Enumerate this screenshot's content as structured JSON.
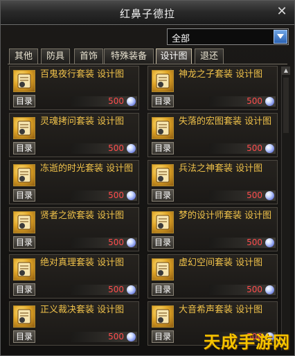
{
  "window": {
    "title": "红鼻子德拉"
  },
  "filter": {
    "selected": "全部"
  },
  "tabs": [
    {
      "label": "其他"
    },
    {
      "label": "防具"
    },
    {
      "label": "首饰"
    },
    {
      "label": "特殊装备"
    },
    {
      "label": "设计图"
    },
    {
      "label": "退还"
    }
  ],
  "active_tab": "设计图",
  "items": [
    {
      "name": "百鬼夜行套装  设计图",
      "catalog": "目录",
      "price": "500"
    },
    {
      "name": "神龙之子套装  设计图",
      "catalog": "目录",
      "price": "500"
    },
    {
      "name": "灵魂拷问套装  设计图",
      "catalog": "目录",
      "price": "500"
    },
    {
      "name": "失落的宏图套装  设计图",
      "catalog": "目录",
      "price": "500"
    },
    {
      "name": "冻逝的时光套装  设计图",
      "catalog": "目录",
      "price": "500"
    },
    {
      "name": "兵法之神套装  设计图",
      "catalog": "目录",
      "price": "500"
    },
    {
      "name": "贤者之欲套装  设计图",
      "catalog": "目录",
      "price": "500"
    },
    {
      "name": "梦的设计师套装  设计图",
      "catalog": "目录",
      "price": "500"
    },
    {
      "name": "绝对真理套装  设计图",
      "catalog": "目录",
      "price": "500"
    },
    {
      "name": "虚幻空间套装  设计图",
      "catalog": "目录",
      "price": "500"
    },
    {
      "name": "正义裁决套装  设计图",
      "catalog": "目录",
      "price": "500"
    },
    {
      "name": "大音希声套装  设计图",
      "catalog": "目录",
      "price": "500"
    }
  ],
  "watermark": "天成手游网",
  "colors": {
    "item_name": "#f0c24a",
    "price": "#ff4d4d",
    "dropdown_accent": "#2b62b3"
  },
  "icons": {
    "close": "close-icon",
    "dropdown": "chevron-down-icon",
    "item": "blueprint-icon",
    "currency": "crystal-coin-icon"
  }
}
